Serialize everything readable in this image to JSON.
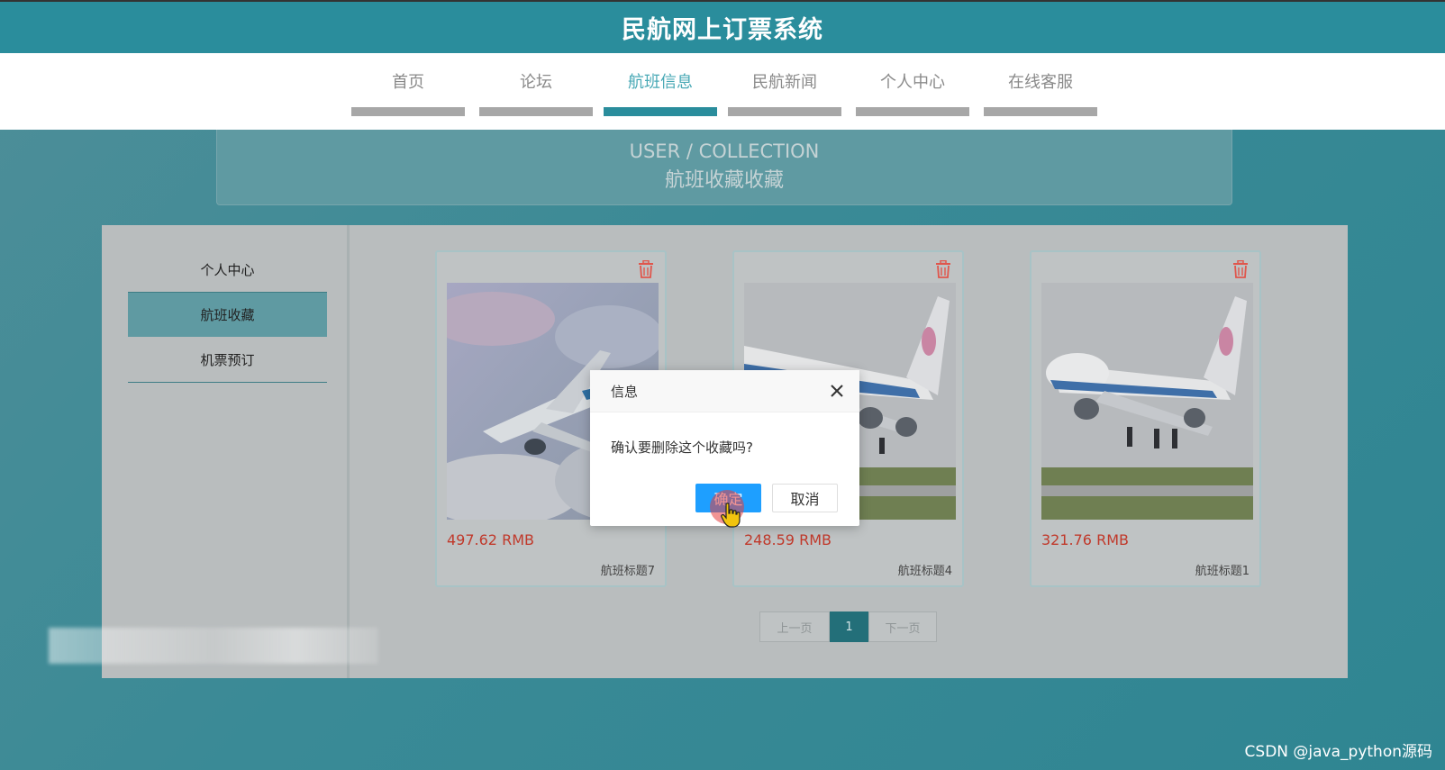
{
  "header": {
    "title": "民航网上订票系统"
  },
  "nav": {
    "items": [
      {
        "label": "首页"
      },
      {
        "label": "论坛"
      },
      {
        "label": "航班信息"
      },
      {
        "label": "民航新闻"
      },
      {
        "label": "个人中心"
      },
      {
        "label": "在线客服"
      }
    ],
    "active_index": 2
  },
  "banner": {
    "en": "USER / COLLECTION",
    "cn": "航班收藏收藏"
  },
  "sidebar": {
    "items": [
      {
        "label": "个人中心"
      },
      {
        "label": "航班收藏"
      },
      {
        "label": "机票预订"
      }
    ],
    "active_index": 1
  },
  "cards": [
    {
      "price": "497.62 RMB",
      "title": "航班标题7",
      "icon": "trash-icon"
    },
    {
      "price": "248.59 RMB",
      "title": "航班标题4",
      "icon": "trash-icon"
    },
    {
      "price": "321.76 RMB",
      "title": "航班标题1",
      "icon": "trash-icon"
    }
  ],
  "pagination": {
    "prev": "上一页",
    "current": "1",
    "next": "下一页"
  },
  "dialog": {
    "title": "信息",
    "message": "确认要删除这个收藏吗?",
    "confirm": "确定",
    "cancel": "取消"
  },
  "watermark": "CSDN @java_python源码",
  "colors": {
    "header": "#2a8d9c",
    "accent": "#2a8d9c",
    "price": "#c0392b",
    "confirm_button": "#1e9fff",
    "delete_icon": "#e0564c"
  }
}
